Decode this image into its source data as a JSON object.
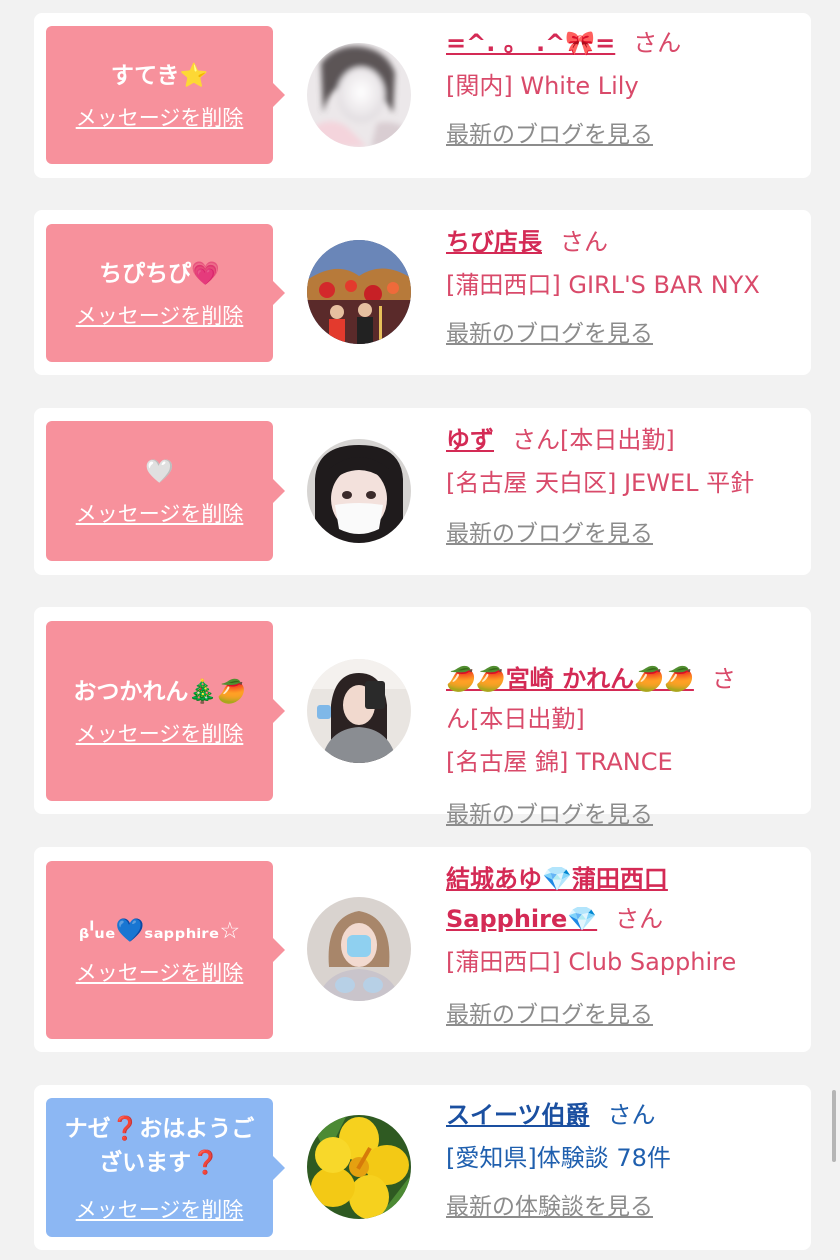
{
  "colors": {
    "bubble_pink": "#f7919c",
    "bubble_blue": "#8cb7f3",
    "name_pink": "#d42a55",
    "name_blue": "#1a4fa0",
    "link_gray": "#8c8c8c",
    "page_bg": "#f2f2f2"
  },
  "cards": [
    {
      "message": "すてき⭐",
      "delete_label": "メッセージを削除",
      "avatar_icon": "blurred-face-photo",
      "name": "=^. 。 .^🎀=",
      "honorific": "さん",
      "shop": "[関内] White Lily",
      "blog_link": "最新のブログを見る"
    },
    {
      "message": "ちぴちぴ💗",
      "delete_label": "メッセージを削除",
      "avatar_icon": "festival-stage-photo",
      "name": "ちび店長",
      "honorific": "さん",
      "shop": "[蒲田西口] GIRL'S BAR NYX",
      "blog_link": "最新のブログを見る"
    },
    {
      "message": "🤍",
      "delete_label": "メッセージを削除",
      "avatar_icon": "masked-girl-photo",
      "name": "ゆず",
      "honorific": "さん[本日出勤]",
      "shop": "[名古屋 天白区] JEWEL 平針",
      "blog_link": "最新のブログを見る"
    },
    {
      "message": "おつかれん🎄🥭",
      "delete_label": "メッセージを削除",
      "avatar_icon": "mirror-selfie-photo",
      "name": "🥭🥭宮崎 かれん🥭🥭",
      "honorific": "さ\nん[本日出勤]",
      "shop": "[名古屋 錦] TRANCE",
      "blog_link": "最新のブログを見る"
    },
    {
      "message": "ᵦˡᵤₑ💙ₛₐₚₚₕᵢᵣₑ☆",
      "delete_label": "メッセージを削除",
      "avatar_icon": "portrait-photo",
      "name_line1": "結城あゆ💎蒲田西口",
      "name_line2": "Sapphire💎",
      "honorific": "さん",
      "shop": "[蒲田西口] Club Sapphire",
      "blog_link": "最新のブログを見る"
    },
    {
      "message": "ナゼ❓おはようご\nざいます❓",
      "delete_label": "メッセージを削除",
      "avatar_icon": "yellow-hibiscus-photo",
      "name": "スイーツ伯爵",
      "honorific": "さん",
      "shop": "[愛知県]体験談 78件",
      "blog_link": "最新の体験談を見る"
    }
  ]
}
